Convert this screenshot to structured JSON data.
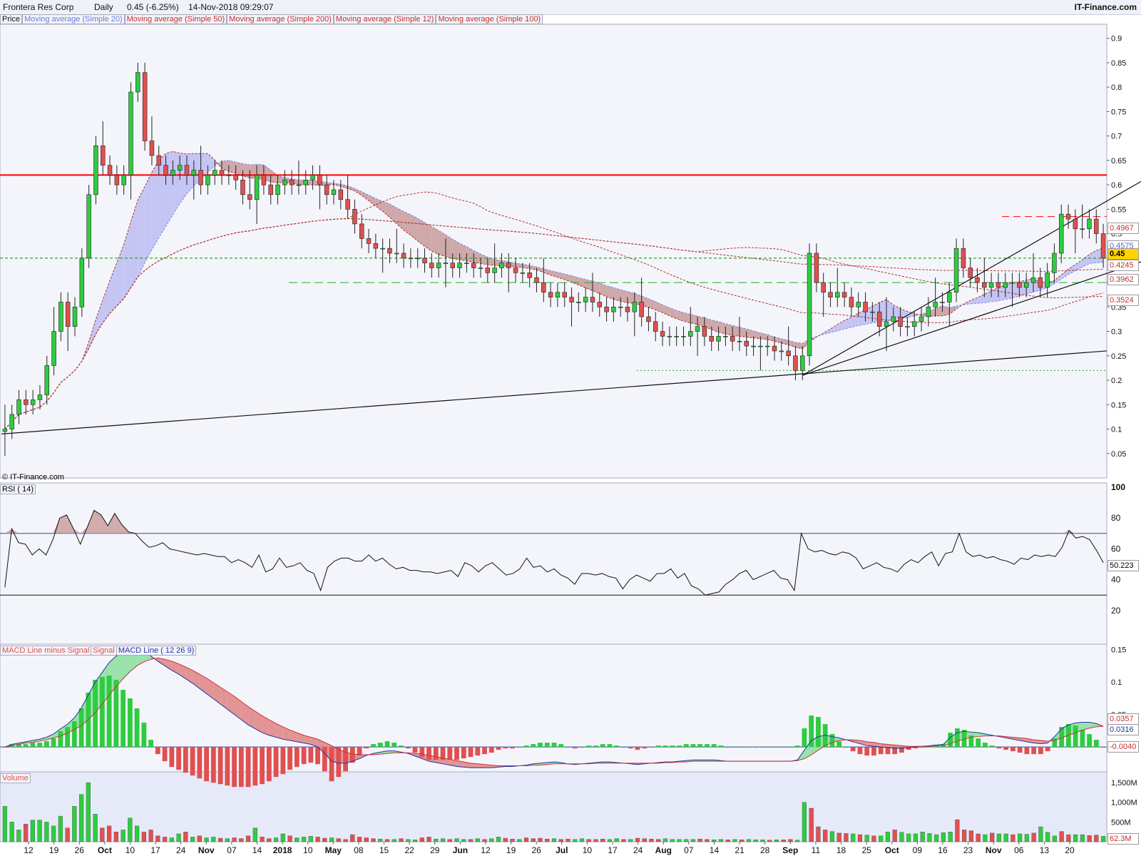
{
  "header": {
    "symbol": "Frontera Res Corp",
    "period": "Daily",
    "quote": "0.45 (-6.25%)",
    "timestamp": "14-Nov-2018 09:29:07",
    "brand": "IT-Finance.com"
  },
  "legend": {
    "price": "Price",
    "ma20": "Moving average (Simple 20)",
    "ma50": "Moving average (Simple 50)",
    "ma200": "Moving average (Simple 200)",
    "ma12": "Moving average (Simple 12)",
    "ma100": "Moving average (Simple 100)"
  },
  "watermark": "© IT-Finance.com",
  "rsi_label": "RSI ( 14)",
  "macd_labels": {
    "hist": "MACD Line minus Signal",
    "signal": "Signal",
    "line": "MACD Line ( 12 26 9)"
  },
  "volume_label": "Volume",
  "colors": {
    "up": "#2ecc40",
    "down": "#e05050",
    "resistance": "#ff0000",
    "support": "#22aa22",
    "ma": "#b03030",
    "fill_blue": "#bcbcf2",
    "fill_red": "#c89a9a",
    "panel_bg": "#e8ecf8"
  },
  "chart_data": {
    "type": "candlestick",
    "x_tick_labels": [
      "12",
      "19",
      "26",
      "Oct",
      "10",
      "17",
      "24",
      "Nov",
      "07",
      "14",
      "2018",
      "10",
      "May",
      "08",
      "15",
      "22",
      "29",
      "Jun",
      "12",
      "19",
      "26",
      "Jul",
      "10",
      "17",
      "24",
      "Aug",
      "07",
      "14",
      "21",
      "28",
      "Sep",
      "11",
      "18",
      "25",
      "Oct",
      "09",
      "16",
      "23",
      "Nov",
      "06",
      "13",
      "20"
    ],
    "price_axis": {
      "ticks": [
        "0.9",
        "0.85",
        "0.8",
        "0.75",
        "0.7",
        "0.65",
        "0.6",
        "0.55",
        "0.5",
        "0.45",
        "0.4",
        "0.35",
        "0.3",
        "0.25",
        "0.2",
        "0.15",
        "0.1",
        "0.05"
      ],
      "min": 0.0,
      "max": 0.92
    },
    "price_tags": [
      "0.4967",
      "0.4575",
      "0.45",
      "0.4245",
      "0.3962",
      "0.3524"
    ],
    "closes": [
      0.1,
      0.13,
      0.16,
      0.15,
      0.16,
      0.17,
      0.23,
      0.3,
      0.36,
      0.31,
      0.35,
      0.45,
      0.58,
      0.68,
      0.64,
      0.62,
      0.6,
      0.62,
      0.79,
      0.83,
      0.69,
      0.66,
      0.64,
      0.62,
      0.63,
      0.64,
      0.62,
      0.63,
      0.6,
      0.62,
      0.63,
      0.62,
      0.62,
      0.61,
      0.58,
      0.57,
      0.62,
      0.6,
      0.58,
      0.6,
      0.61,
      0.6,
      0.6,
      0.61,
      0.62,
      0.6,
      0.58,
      0.59,
      0.57,
      0.55,
      0.52,
      0.49,
      0.48,
      0.47,
      0.47,
      0.46,
      0.46,
      0.45,
      0.45,
      0.45,
      0.44,
      0.43,
      0.44,
      0.44,
      0.43,
      0.44,
      0.44,
      0.43,
      0.43,
      0.42,
      0.43,
      0.44,
      0.43,
      0.42,
      0.42,
      0.41,
      0.4,
      0.38,
      0.37,
      0.38,
      0.37,
      0.36,
      0.36,
      0.37,
      0.36,
      0.35,
      0.34,
      0.35,
      0.35,
      0.34,
      0.36,
      0.33,
      0.32,
      0.3,
      0.29,
      0.29,
      0.29,
      0.29,
      0.3,
      0.31,
      0.29,
      0.28,
      0.29,
      0.29,
      0.28,
      0.28,
      0.27,
      0.27,
      0.27,
      0.27,
      0.26,
      0.26,
      0.25,
      0.22,
      0.25,
      0.46,
      0.4,
      0.38,
      0.37,
      0.38,
      0.37,
      0.35,
      0.36,
      0.34,
      0.34,
      0.31,
      0.32,
      0.33,
      0.31,
      0.31,
      0.32,
      0.33,
      0.35,
      0.36,
      0.36,
      0.38,
      0.47,
      0.43,
      0.41,
      0.4,
      0.39,
      0.4,
      0.39,
      0.4,
      0.4,
      0.39,
      0.4,
      0.41,
      0.39,
      0.42,
      0.46,
      0.54,
      0.53,
      0.51,
      0.51,
      0.53,
      0.5,
      0.45
    ],
    "volume_axis": {
      "ticks": [
        "1,500M",
        "1,000M",
        "500M"
      ],
      "max": 1700
    },
    "volume_tag": "62.3M",
    "volumes": [
      900,
      500,
      300,
      450,
      550,
      550,
      500,
      400,
      650,
      350,
      900,
      1200,
      1500,
      700,
      350,
      400,
      250,
      300,
      600,
      400,
      250,
      300,
      150,
      120,
      100,
      200,
      250,
      120,
      150,
      100,
      120,
      90,
      80,
      100,
      80,
      150,
      350,
      120,
      80,
      100,
      200,
      150,
      100,
      120,
      140,
      120,
      90,
      100,
      80,
      60,
      180,
      120,
      100,
      80,
      70,
      60,
      60,
      80,
      60,
      50,
      100,
      120,
      70,
      80,
      60,
      80,
      60,
      60,
      80,
      60,
      80,
      120,
      90,
      70,
      60,
      100,
      80,
      90,
      70,
      80,
      60,
      70,
      60,
      80,
      60,
      60,
      70,
      60,
      80,
      60,
      60,
      90,
      80,
      70,
      60,
      80,
      60,
      60,
      60,
      60,
      70,
      60,
      50,
      60,
      50,
      60,
      50,
      60,
      50,
      50,
      40,
      50,
      50,
      60,
      40,
      1000,
      850,
      380,
      300,
      260,
      220,
      210,
      200,
      180,
      170,
      150,
      150,
      250,
      300,
      240,
      200,
      200,
      250,
      210,
      180,
      230,
      250,
      560,
      300,
      280,
      200,
      180,
      220,
      200,
      200,
      180,
      200,
      190,
      220,
      380,
      240,
      150,
      260,
      180,
      180,
      180,
      160,
      170,
      140
    ],
    "rsi_axis": {
      "ticks": [
        "100",
        "80",
        "60",
        "40",
        "20"
      ],
      "upper": 70,
      "lower": 30
    },
    "rsi_tag": "50.223",
    "rsi": [
      35,
      73,
      64,
      63,
      56,
      60,
      56,
      66,
      80,
      82,
      73,
      63,
      74,
      85,
      82,
      75,
      83,
      76,
      71,
      70,
      65,
      61,
      62,
      64,
      60,
      59,
      58,
      57,
      56,
      57,
      56,
      55,
      55,
      51,
      53,
      51,
      48,
      56,
      45,
      47,
      54,
      48,
      49,
      51,
      46,
      44,
      33,
      48,
      52,
      54,
      54,
      52,
      52,
      56,
      52,
      54,
      50,
      47,
      48,
      46,
      46,
      45,
      45,
      44,
      45,
      46,
      42,
      51,
      49,
      45,
      49,
      51,
      47,
      43,
      44,
      47,
      54,
      48,
      49,
      45,
      47,
      43,
      41,
      37,
      44,
      44,
      43,
      44,
      42,
      41,
      34,
      40,
      43,
      41,
      39,
      44,
      44,
      47,
      41,
      44,
      36,
      34,
      30,
      31,
      32,
      37,
      40,
      44,
      46,
      40,
      42,
      44,
      46,
      41,
      40,
      33,
      70,
      60,
      58,
      59,
      57,
      56,
      58,
      57,
      54,
      47,
      49,
      51,
      48,
      47,
      45,
      50,
      53,
      51,
      55,
      58,
      49,
      57,
      58,
      70,
      58,
      55,
      56,
      54,
      55,
      53,
      52,
      50,
      54,
      53,
      56,
      55,
      56,
      55,
      61,
      72,
      67,
      68,
      66,
      59,
      51
    ],
    "macd_axis": {
      "ticks": [
        "0.15",
        "0.1",
        "0.05"
      ],
      "min": -0.035,
      "max": 0.155
    },
    "macd_tags": [
      "0.0357",
      "0.0316",
      "-0.0040"
    ],
    "macd_line": [
      0.0,
      0.004,
      0.006,
      0.008,
      0.01,
      0.012,
      0.015,
      0.02,
      0.028,
      0.035,
      0.045,
      0.06,
      0.08,
      0.1,
      0.115,
      0.13,
      0.14,
      0.145,
      0.15,
      0.152,
      0.148,
      0.14,
      0.132,
      0.125,
      0.118,
      0.112,
      0.105,
      0.098,
      0.09,
      0.082,
      0.074,
      0.066,
      0.058,
      0.05,
      0.042,
      0.034,
      0.028,
      0.022,
      0.018,
      0.015,
      0.012,
      0.01,
      0.008,
      0.006,
      0.004,
      0.0,
      -0.01,
      -0.022,
      -0.025,
      -0.025,
      -0.022,
      -0.018,
      -0.013,
      -0.01,
      -0.008,
      -0.006,
      -0.006,
      -0.008,
      -0.01,
      -0.014,
      -0.018,
      -0.022,
      -0.024,
      -0.026,
      -0.028,
      -0.03,
      -0.031,
      -0.032,
      -0.032,
      -0.032,
      -0.032,
      -0.031,
      -0.03,
      -0.03,
      -0.029,
      -0.028,
      -0.026,
      -0.025,
      -0.024,
      -0.023,
      -0.024,
      -0.026,
      -0.027,
      -0.026,
      -0.025,
      -0.024,
      -0.023,
      -0.023,
      -0.024,
      -0.025,
      -0.026,
      -0.027,
      -0.026,
      -0.025,
      -0.024,
      -0.023,
      -0.023,
      -0.022,
      -0.021,
      -0.02,
      -0.02,
      -0.02,
      -0.02,
      -0.021,
      -0.022,
      -0.022,
      -0.022,
      -0.022,
      -0.022,
      -0.022,
      -0.022,
      -0.022,
      -0.022,
      -0.022,
      -0.02,
      -0.005,
      0.01,
      0.016,
      0.018,
      0.016,
      0.014,
      0.011,
      0.008,
      0.005,
      0.002,
      0.001,
      0.0,
      -0.001,
      -0.002,
      -0.002,
      -0.001,
      0.0,
      0.001,
      0.002,
      0.003,
      0.004,
      0.015,
      0.022,
      0.024,
      0.023,
      0.022,
      0.02,
      0.018,
      0.016,
      0.014,
      0.012,
      0.01,
      0.008,
      0.006,
      0.005,
      0.006,
      0.016,
      0.028,
      0.034,
      0.037,
      0.038,
      0.038,
      0.036,
      0.032
    ],
    "signal_line": [
      0.0,
      0.002,
      0.004,
      0.006,
      0.007,
      0.009,
      0.011,
      0.014,
      0.017,
      0.021,
      0.027,
      0.033,
      0.042,
      0.053,
      0.066,
      0.08,
      0.093,
      0.105,
      0.116,
      0.125,
      0.131,
      0.135,
      0.137,
      0.135,
      0.132,
      0.128,
      0.123,
      0.118,
      0.112,
      0.106,
      0.099,
      0.092,
      0.085,
      0.078,
      0.07,
      0.062,
      0.055,
      0.048,
      0.042,
      0.036,
      0.031,
      0.026,
      0.022,
      0.018,
      0.015,
      0.012,
      0.007,
      0.002,
      -0.004,
      -0.008,
      -0.011,
      -0.012,
      -0.012,
      -0.012,
      -0.011,
      -0.01,
      -0.009,
      -0.009,
      -0.009,
      -0.01,
      -0.011,
      -0.013,
      -0.015,
      -0.017,
      -0.019,
      -0.021,
      -0.023,
      -0.025,
      -0.026,
      -0.027,
      -0.028,
      -0.029,
      -0.029,
      -0.029,
      -0.029,
      -0.029,
      -0.028,
      -0.028,
      -0.027,
      -0.026,
      -0.026,
      -0.026,
      -0.026,
      -0.026,
      -0.026,
      -0.025,
      -0.025,
      -0.025,
      -0.025,
      -0.025,
      -0.025,
      -0.025,
      -0.025,
      -0.025,
      -0.025,
      -0.024,
      -0.024,
      -0.023,
      -0.023,
      -0.022,
      -0.022,
      -0.022,
      -0.022,
      -0.022,
      -0.022,
      -0.022,
      -0.022,
      -0.022,
      -0.022,
      -0.022,
      -0.022,
      -0.022,
      -0.022,
      -0.022,
      -0.021,
      -0.018,
      -0.012,
      -0.005,
      0.002,
      0.007,
      0.01,
      0.011,
      0.011,
      0.01,
      0.008,
      0.007,
      0.005,
      0.004,
      0.003,
      0.002,
      0.001,
      0.001,
      0.001,
      0.001,
      0.002,
      0.002,
      0.005,
      0.009,
      0.012,
      0.015,
      0.016,
      0.017,
      0.017,
      0.017,
      0.016,
      0.015,
      0.014,
      0.013,
      0.011,
      0.01,
      0.009,
      0.01,
      0.014,
      0.018,
      0.022,
      0.026,
      0.029,
      0.031,
      0.032
    ]
  }
}
